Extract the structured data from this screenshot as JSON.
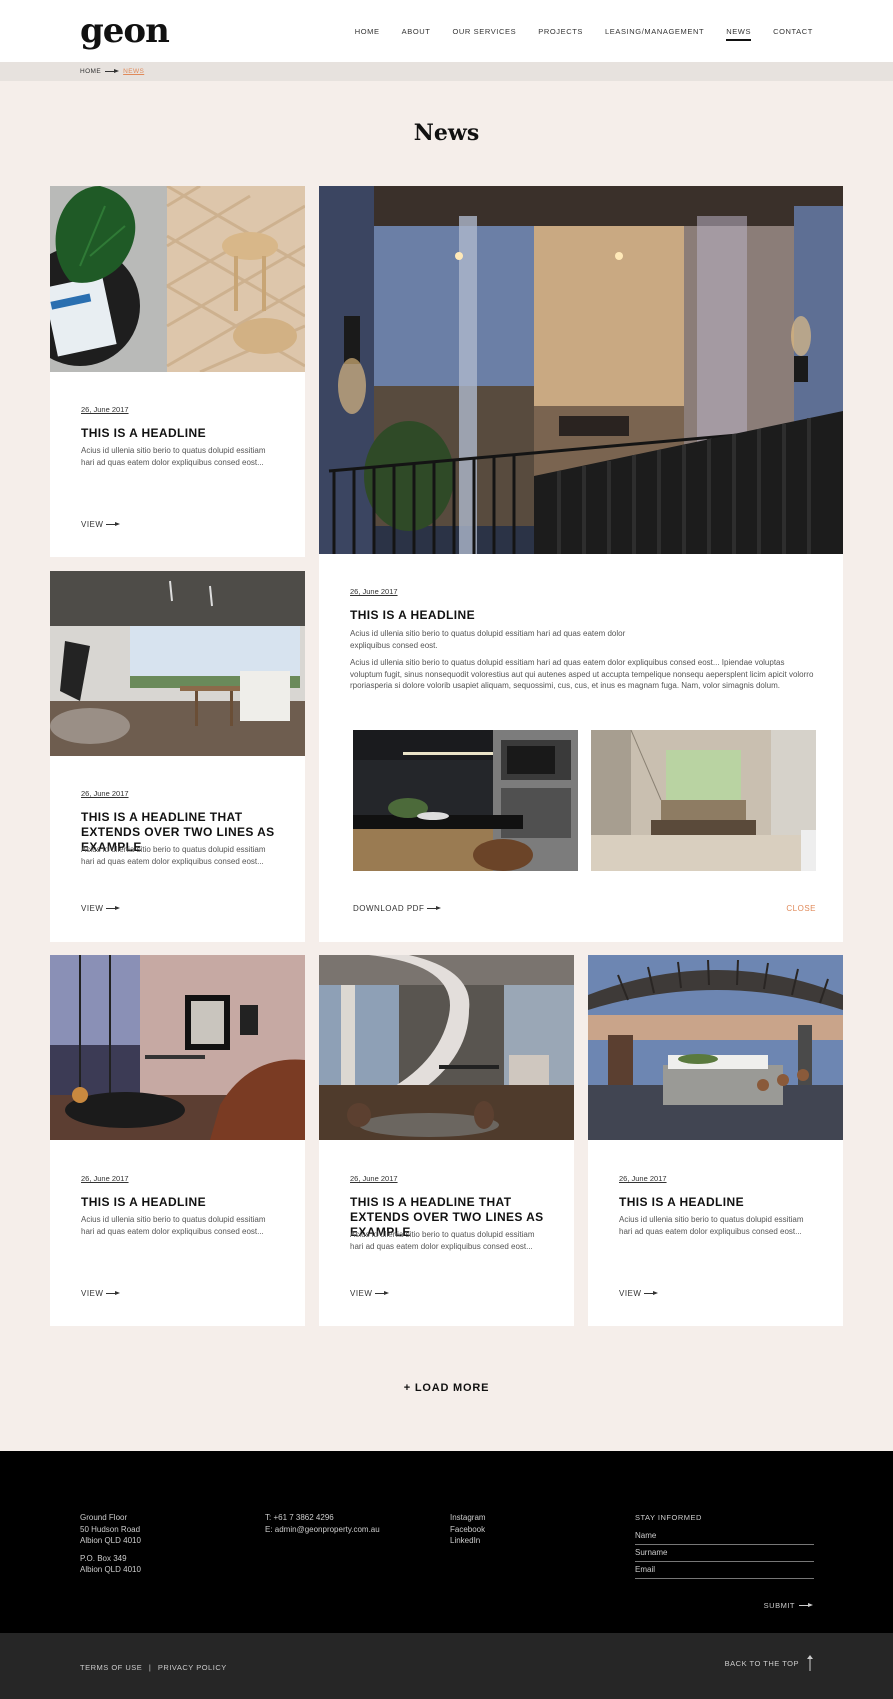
{
  "brand": {
    "logo": "geon"
  },
  "nav": {
    "items": [
      {
        "label": "HOME",
        "active": false
      },
      {
        "label": "ABOUT",
        "active": false
      },
      {
        "label": "OUR SERVICES",
        "active": false
      },
      {
        "label": "PROJECTS",
        "active": false
      },
      {
        "label": "LEASING/MANAGEMENT",
        "active": false
      },
      {
        "label": "NEWS",
        "active": true
      },
      {
        "label": "CONTACT",
        "active": false
      }
    ]
  },
  "breadcrumb": {
    "home": "HOME",
    "current": "NEWS"
  },
  "page": {
    "title": "News"
  },
  "cards": [
    {
      "date": "26, June 2017",
      "headline": "THIS IS A HEADLINE",
      "excerpt": "Acius id ullenia sitio berio to quatus dolupid essitiam hari ad quas eatem dolor expliquibus consed eost...",
      "view": "VIEW"
    },
    {
      "date": "26, June 2017",
      "headline": "THIS IS A HEADLINE THAT EXTENDS OVER TWO LINES AS EXAMPLE",
      "excerpt": "Acius id ullenia sitio berio to quatus dolupid essitiam hari ad quas eatem dolor expliquibus consed eost...",
      "view": "VIEW"
    },
    {
      "date": "26, June 2017",
      "headline": "THIS IS A HEADLINE",
      "excerpt": "Acius id ullenia sitio berio to quatus dolupid essitiam hari ad quas eatem dolor expliquibus consed eost...",
      "view": "VIEW"
    },
    {
      "date": "26, June 2017",
      "headline": "THIS IS A HEADLINE THAT EXTENDS OVER TWO LINES AS EXAMPLE",
      "excerpt": "Acius id ullenia sitio berio to quatus dolupid essitiam hari ad quas eatem dolor expliquibus consed eost...",
      "view": "VIEW"
    },
    {
      "date": "26, June 2017",
      "headline": "THIS IS A HEADLINE",
      "excerpt": "Acius id ullenia sitio berio to quatus dolupid essitiam hari ad quas eatem dolor expliquibus consed eost...",
      "view": "VIEW"
    }
  ],
  "feature": {
    "date": "26, June 2017",
    "headline": "THIS IS A HEADLINE",
    "lead": "Acius id ullenia sitio berio to quatus dolupid essitiam hari ad quas eatem dolor expliquibus consed eost.",
    "body": "Acius id ullenia sitio berio to quatus dolupid essitiam hari ad quas eatem dolor expliquibus consed eost... Ipiendae voluptas voluptum fugit, sinus nonsequodit volorestius aut qui autenes asped ut accupta tempelique nonsequ aepersplent licim apicit volorro rporiasperia si dolore volorib usapiet aliquam, sequossimi, cus, cus, et inus es magnam fuga. Nam, volor simagnis dolum.",
    "download": "DOWNLOAD PDF",
    "close": "CLOSE"
  },
  "load_more": "+ LOAD MORE",
  "footer": {
    "address1": [
      "Ground Floor",
      "50 Hudson Road",
      "Albion QLD 4010"
    ],
    "address2": [
      "P.O. Box 349",
      "Albion QLD 4010"
    ],
    "phone": "T: +61 7 3862 4296",
    "email": "E: admin@geonproperty.com.au",
    "social": [
      "Instagram",
      "Facebook",
      "LinkedIn"
    ],
    "newsletter": {
      "title": "STAY INFORMED",
      "name_placeholder": "Name",
      "surname_placeholder": "Surname",
      "email_placeholder": "Email",
      "submit": "SUBMIT"
    },
    "terms": "TERMS OF USE",
    "privacy": "PRIVACY POLICY",
    "separator": "|",
    "back_to_top": "BACK TO THE TOP"
  },
  "colors": {
    "accent": "#e08a5a",
    "page_bg": "#f5eeea",
    "footer_bg": "#000000",
    "bottom_bar_bg": "#262626"
  }
}
